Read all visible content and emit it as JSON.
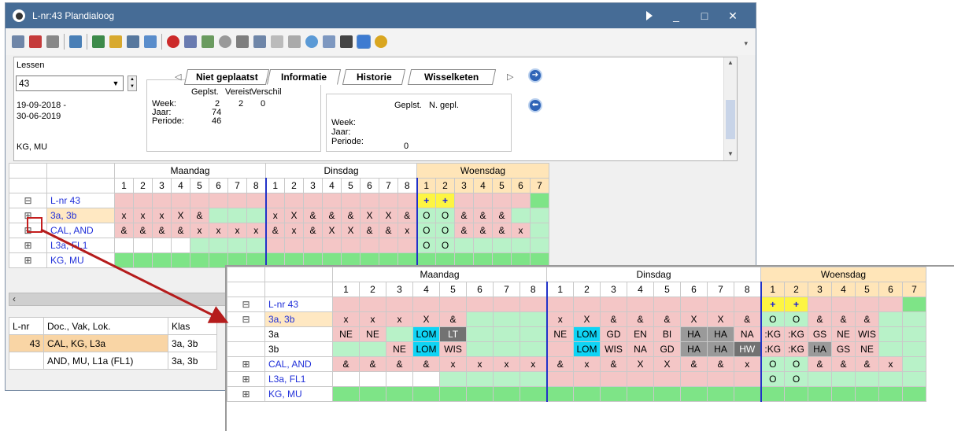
{
  "window": {
    "title": "L-nr:43  Plandialoog"
  },
  "lessons_header": "Lessen",
  "lesson_no": "43",
  "dates": [
    "19-09-2018 -",
    "30-06-2019"
  ],
  "teachers": "KG, MU",
  "tabs": [
    "Niet geplaatst",
    "Informatie",
    "Historie",
    "Wisselketen"
  ],
  "info1": {
    "cols": [
      "Geplst.",
      "Vereist",
      "Verschil"
    ],
    "rows": [
      {
        "label": "Week:",
        "values": [
          "2",
          "2",
          "0"
        ]
      },
      {
        "label": "Jaar:",
        "values": [
          "74",
          "",
          ""
        ]
      },
      {
        "label": "Periode:",
        "values": [
          "46",
          "",
          ""
        ]
      }
    ]
  },
  "info2": {
    "cols": [
      "Geplst.",
      "N. gepl."
    ],
    "rows": [
      {
        "label": "Week:",
        "values": [
          "",
          ""
        ]
      },
      {
        "label": "Jaar:",
        "values": [
          "",
          ""
        ]
      },
      {
        "label": "Periode:",
        "values": [
          "0",
          ""
        ]
      }
    ]
  },
  "days": [
    "Maandag",
    "Dinsdag",
    "Woensdag"
  ],
  "periods": [
    "1",
    "2",
    "3",
    "4",
    "5",
    "6",
    "7",
    "8"
  ],
  "grid1": {
    "rows": [
      {
        "exp": "⊟",
        "label": "L-nr 43",
        "cells": [
          "",
          "",
          "",
          "",
          "",
          "",
          "",
          "",
          "",
          "",
          "",
          "",
          "",
          "",
          "",
          "",
          "+",
          "+",
          "",
          "",
          "",
          "",
          ""
        ]
      },
      {
        "exp": "⊞",
        "label": "3a, 3b",
        "cells": [
          "x",
          "x",
          "x",
          "X",
          "&",
          "",
          "",
          "",
          "x",
          "X",
          "&",
          "&",
          "&",
          "X",
          "X",
          "&",
          "O",
          "O",
          "&",
          "&",
          "&",
          "",
          ""
        ]
      },
      {
        "exp": "⊞",
        "label": "CAL, AND",
        "cells": [
          "&",
          "&",
          "&",
          "&",
          "x",
          "x",
          "x",
          "x",
          "&",
          "x",
          "&",
          "X",
          "X",
          "&",
          "&",
          "x",
          "O",
          "O",
          "&",
          "&",
          "&",
          "x",
          ""
        ]
      },
      {
        "exp": "⊞",
        "label": "L3a, FL1",
        "cells": [
          "",
          "",
          "",
          "",
          "",
          "",
          "",
          "",
          "",
          "",
          "",
          "",
          "",
          "",
          "",
          "",
          "O",
          "O",
          "",
          "",
          "",
          "",
          ""
        ]
      },
      {
        "exp": "⊞",
        "label": "KG, MU",
        "cells": [
          "",
          "",
          "",
          "",
          "",
          "",
          "",
          "",
          "",
          "",
          "",
          "",
          "",
          "",
          "",
          "",
          "",
          "",
          "",
          "",
          "",
          "",
          ""
        ]
      }
    ]
  },
  "lesson_list": {
    "headers": [
      "L-nr",
      "Doc., Vak, Lok.",
      "Klas"
    ],
    "rows": [
      {
        "nr": "43",
        "desc": "CAL, KG, L3a",
        "klas": "3a, 3b"
      },
      {
        "nr": "",
        "desc": "AND, MU, L1a (FL1)",
        "klas": "3a, 3b"
      }
    ]
  },
  "grid2": {
    "rows": [
      {
        "exp": "⊟",
        "label": "L-nr 43",
        "cells": [
          "",
          "",
          "",
          "",
          "",
          "",
          "",
          "",
          "",
          "",
          "",
          "",
          "",
          "",
          "",
          "",
          "+",
          "+",
          "",
          "",
          "",
          "",
          ""
        ]
      },
      {
        "exp": "⊟",
        "label": "3a, 3b",
        "cells": [
          "x",
          "x",
          "x",
          "X",
          "&",
          "",
          "",
          "",
          "x",
          "X",
          "&",
          "&",
          "&",
          "X",
          "X",
          "&",
          "O",
          "O",
          "&",
          "&",
          "&",
          "",
          ""
        ]
      },
      {
        "exp": "",
        "label": "3a",
        "cells": [
          "NE",
          "NE",
          "",
          "LOM",
          "LT",
          "",
          "",
          "",
          "NE",
          "LOM",
          "GD",
          "EN",
          "BI",
          "HA",
          "HA",
          "NA",
          ":KG",
          ":KG",
          "GS",
          "NE",
          "WIS",
          "",
          ""
        ]
      },
      {
        "exp": "",
        "label": "3b",
        "cells": [
          "",
          "",
          "NE",
          "LOM",
          "WIS",
          "",
          "",
          "",
          "",
          "LOM",
          "WIS",
          "NA",
          "GD",
          "HA",
          "HA",
          "HW",
          ":KG",
          ":KG",
          "HA",
          "GS",
          "NE",
          "",
          ""
        ]
      },
      {
        "exp": "⊞",
        "label": "CAL, AND",
        "cells": [
          "&",
          "&",
          "&",
          "&",
          "x",
          "x",
          "x",
          "x",
          "&",
          "x",
          "&",
          "X",
          "X",
          "&",
          "&",
          "x",
          "O",
          "O",
          "&",
          "&",
          "&",
          "x",
          ""
        ]
      },
      {
        "exp": "⊞",
        "label": "L3a, FL1",
        "cells": [
          "",
          "",
          "",
          "",
          "",
          "",
          "",
          "",
          "",
          "",
          "",
          "",
          "",
          "",
          "",
          "",
          "O",
          "O",
          "",
          "",
          "",
          "",
          ""
        ]
      },
      {
        "exp": "⊞",
        "label": "KG, MU",
        "cells": [
          "",
          "",
          "",
          "",
          "",
          "",
          "",
          "",
          "",
          "",
          "",
          "",
          "",
          "",
          "",
          "",
          "",
          "",
          "",
          "",
          "",
          "",
          ""
        ]
      }
    ]
  }
}
